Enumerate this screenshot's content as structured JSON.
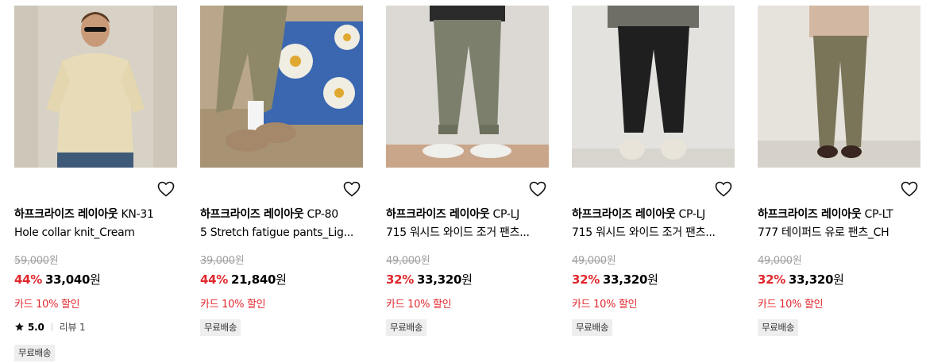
{
  "products": [
    {
      "brand": "하프크라이즈 레이아웃",
      "name_line1": "KN-31",
      "name_line2": "Hole collar knit_Cream",
      "original_price": "59,000",
      "discount": "44%",
      "price": "33,040",
      "currency": "원",
      "card_promo": "카드 10% 할인",
      "rating": "5.0",
      "reviews": "리뷰 1",
      "badge": "무료배송",
      "image": "model-in-cream-knit-polo",
      "colors": {
        "bg": "#d7d1c6",
        "top": "#e8dcb8",
        "bottom": "#3f5a78"
      }
    },
    {
      "brand": "하프크라이즈 레이아웃",
      "name_line1": "CP-80",
      "name_line2": "5 Stretch fatigue pants_Lig...",
      "original_price": "39,000",
      "discount": "44%",
      "price": "21,840",
      "currency": "원",
      "card_promo": "카드 10% 할인",
      "badge": "무료배송",
      "image": "olive-pants-seated-on-daisy-blanket",
      "colors": {
        "bg": "#b9a68b",
        "top": "#3a67b0",
        "bottom": "#8e8868"
      }
    },
    {
      "brand": "하프크라이즈 레이아웃",
      "name_line1": "CP-LJ",
      "name_line2": "715 워시드 와이드 조거 팬츠...",
      "original_price": "49,000",
      "discount": "32%",
      "price": "33,320",
      "currency": "원",
      "card_promo": "카드 10% 할인",
      "badge": "무료배송",
      "image": "khaki-jogger-pants",
      "colors": {
        "bg": "#dcd9d4",
        "top": "#2a2a2a",
        "bottom": "#7c7f6c"
      }
    },
    {
      "brand": "하프크라이즈 레이아웃",
      "name_line1": "CP-LJ",
      "name_line2": "715 워시드 와이드 조거 팬츠...",
      "original_price": "49,000",
      "discount": "32%",
      "price": "33,320",
      "currency": "원",
      "card_promo": "카드 10% 할인",
      "badge": "무료배송",
      "image": "black-jogger-pants",
      "colors": {
        "bg": "#e3e2df",
        "top": "#6e6e66",
        "bottom": "#1f1f1f"
      }
    },
    {
      "brand": "하프크라이즈 레이아웃",
      "name_line1": "CP-LT",
      "name_line2": "777 테이퍼드 유로 팬츠_CH",
      "original_price": "49,000",
      "discount": "32%",
      "price": "33,320",
      "currency": "원",
      "card_promo": "카드 10% 할인",
      "badge": "무료배송",
      "image": "olive-tapered-trousers",
      "colors": {
        "bg": "#e6e3dd",
        "top": "#d2b8a3",
        "bottom": "#7a7559"
      }
    }
  ]
}
